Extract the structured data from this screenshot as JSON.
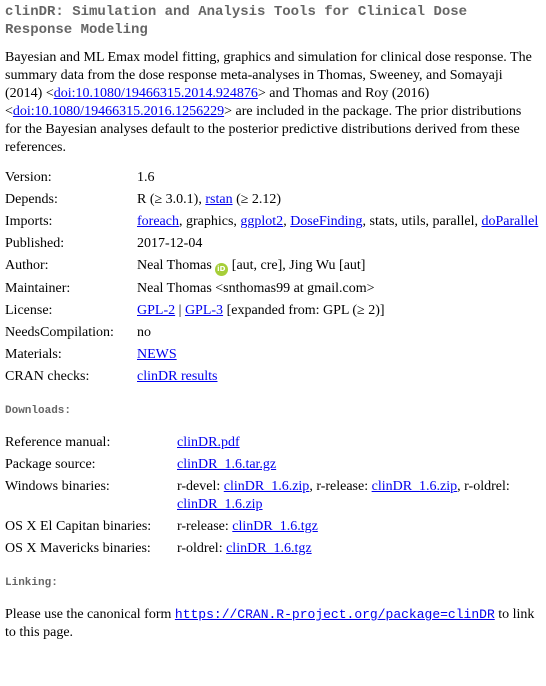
{
  "title": "clinDR: Simulation and Analysis Tools for Clinical Dose Response Modeling",
  "description": {
    "part1": "Bayesian and ML Emax model fitting, graphics and simulation for clinical dose response. The summary data from the dose response meta-analyses in Thomas, Sweeney, and Somayaji (2014) <",
    "doi1": "doi:10.1080/19466315.2014.924876",
    "part2": "> and Thomas and Roy (2016) <",
    "doi2": "doi:10.1080/19466315.2016.1256229",
    "part3": "> are included in the package. The prior distributions for the Bayesian analyses default to the posterior predictive distributions derived from these references."
  },
  "meta": {
    "version_label": "Version:",
    "version": "1.6",
    "depends_label": "Depends:",
    "depends_r": "R (≥ 3.0.1), ",
    "depends_rstan": "rstan",
    "depends_rstan_ver": " (≥ 2.12)",
    "imports_label": "Imports:",
    "imports_foreach": "foreach",
    "imports_sep1": ", graphics, ",
    "imports_ggplot2": "ggplot2",
    "imports_sep2": ", ",
    "imports_dosefinding": "DoseFinding",
    "imports_sep3": ", stats, utils, parallel, ",
    "imports_doparallel": "doParallel",
    "published_label": "Published:",
    "published": "2017-12-04",
    "author_label": "Author:",
    "author_name": "Neal Thomas",
    "author_orcid": "iD",
    "author_rest": "[aut, cre], Jing Wu [aut]",
    "maintainer_label": "Maintainer:",
    "maintainer": "Neal Thomas <snthomas99 at gmail.com>",
    "license_label": "License:",
    "license_gpl2": "GPL-2",
    "license_sep": " | ",
    "license_gpl3": "GPL-3",
    "license_rest": " [expanded from: GPL (≥ 2)]",
    "needs_label": "NeedsCompilation:",
    "needs": "no",
    "materials_label": "Materials:",
    "materials": "NEWS",
    "checks_label": "CRAN checks:",
    "checks": "clinDR results"
  },
  "downloads": {
    "heading": "Downloads:",
    "ref_label": "Reference manual:",
    "ref": "clinDR.pdf",
    "src_label": "Package source:",
    "src": "clinDR_1.6.tar.gz",
    "win_label": "Windows binaries:",
    "win_devel_label": "r-devel: ",
    "win_devel": "clinDR_1.6.zip",
    "win_release_label": ", r-release: ",
    "win_release": "clinDR_1.6.zip",
    "win_oldrel_label": ", r-oldrel: ",
    "win_oldrel": "clinDR_1.6.zip",
    "osx_el_label": "OS X El Capitan binaries:",
    "osx_el_prefix": "r-release: ",
    "osx_el": "clinDR_1.6.tgz",
    "osx_mav_label": "OS X Mavericks binaries:",
    "osx_mav_prefix": "r-oldrel: ",
    "osx_mav": "clinDR_1.6.tgz"
  },
  "linking": {
    "heading": "Linking:",
    "text1": "Please use the canonical form ",
    "url": "https://CRAN.R-project.org/package=clinDR",
    "text2": " to link to this page."
  }
}
